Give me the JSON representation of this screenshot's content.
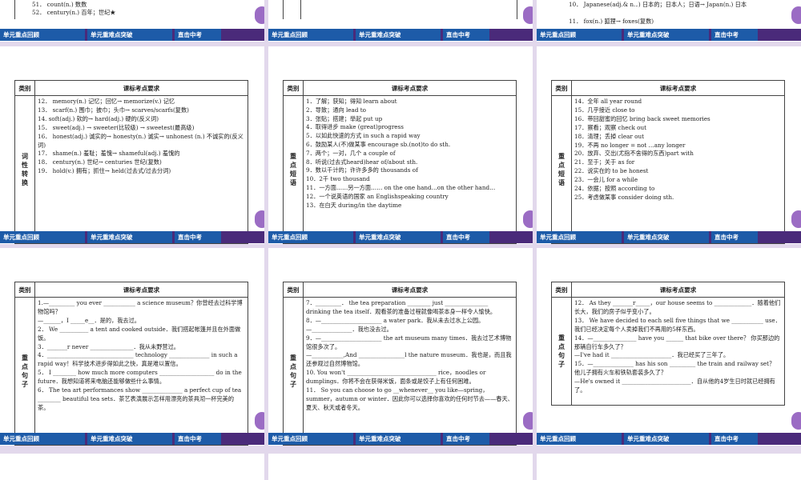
{
  "nav": [
    "单元重点回顾",
    "单元重难点突破",
    "直击中考"
  ],
  "top_slides": [
    {
      "lines": [
        "51． count(n.) 数数",
        "52． century(n.) 百年；世纪★"
      ]
    },
    {
      "lines": []
    },
    {
      "lines": [
        "10． Japanese(adj.& n.．) 日本的；日本人；日语→ Japan(n.) 日本",
        "11． fox(n.) 狐狸→ foxes(复数)"
      ]
    }
  ],
  "table_header": {
    "category": "类别",
    "requirement": "课标考点要求"
  },
  "middle_slides": [
    {
      "category": "词\n性\n转\n换",
      "lines": [
        "12． memory(n.) 记忆；回忆→ memorize(v.) 记忆",
        "13． scarf(n.) 围巾；披巾；头巾→ scarves/scarfs(复数)",
        "14. soft(adj.) 软的→ hard(adj.) 硬的(反义词)",
        "15． sweet(adj.) → sweeter(比较级) → sweetest(最高级)",
        "16． honest(adj.) 诚实的→ honesty(n.) 诚实→ unhonest (n.) 不诚实的(反义词)",
        "17． shame(n.) 羞耻；羞愧→ shameful(adj.) 羞愧的",
        "18． century(n.) 世纪→ centuries 世纪(复数)",
        "19． hold(v.) 拥有；抓住→ held(过去式/过去分词)"
      ]
    },
    {
      "category": "重\n点\n短\n语",
      "lines": [
        "1．了解；获知；得知 learn about",
        "2．导致；通向 lead to",
        "3．张贴；搭建；举起 put up",
        "4．取得进步 make (great)progress",
        "5．以如此快速的方式 in such a rapid way",
        "6．鼓励某人(不)做某事 encourage sb.(not)to do sth.",
        "7．两个；一对，几个 a couple of",
        "8．听说(过去式heard)hear of/about sth.",
        "9．数以千计的；许许多多的 thousands of",
        "10．2千 two thousand",
        "11．一方面……另一方面…… on the one hand…on the other hand…",
        "12．一个说英语的国家 an Englishspeaking country",
        "13．在白天 during/in the daytime"
      ]
    },
    {
      "category": "重\n点\n短\n语",
      "lines": [
        "14．全年 all year round",
        "15．几乎接近 close to",
        "16．带回甜蜜的回忆 bring back sweet memories",
        "17．察看；观察 check out",
        "18．清理；丢掉 clear out",
        "19．不再 no longer = not …any longer",
        "20．放弃、交出(尤指不舍得的东西)part with",
        "21．至于；关于 as for",
        "22．说实在的 to be honest",
        "23．一会儿 for a while",
        "24．依据；按照 according to",
        "25．考虑做某事 consider doing sth."
      ]
    }
  ],
  "bottom_row_slides": [
    {
      "category": "重\n点\n句\n子",
      "lines": [
        "1.—_________ you ever ___________ a science museum？你曾经去过科学博物馆吗？",
        "—______，I _____e__．是的，我去过。",
        "2． We __________ a tent and cooked outside．我们搭起帐篷并且在外面做饭。",
        "3．_______r never _______________．我从未野营过。",
        "4．______________________________ technology ______________ in such a rapid way！科学技术进步得如此之快，真是难以置信。",
        "5． I ________ how much more computers ___________________ do in the future．我想知道将来电脑还能够做些什么事情。",
        "6． The tea art performances show ______________ a perfect cup of tea ________ beautiful tea sets．茶艺表演展示怎样用漂亮的茶具沏一杯完美的茶。"
      ]
    },
    {
      "category": "重\n点\n句\n子",
      "lines": [
        "7．_________． the tea preparation ________ just _______________ drinking the tea itself．观看茶的准备过程就像喝茶本身一样令人愉快。",
        "8．—_____________________ a water park．我从未去过水上公园。",
        "—______________．我也没去过。",
        "9．—_____________________ the art museum many times．我去过艺术博物馆很多次了。",
        "—___________,And ________________l the nature museum．我也是，而且我还参观过自然博物馆。",
        "10. You won't _______________________________ rice，noodles or dumplings．你将不会在获得米饭，面条或是饺子上有任何困难。",
        "11． So you can choose to go __whenever__ you like—spring，summer，autumn or winter．因此你可以选择你喜欢的任何时节去——春天、夏天、秋天或者冬天。"
      ]
    },
    {
      "category": "重\n点\n句\n子",
      "lines": [
        "12． As they _______r_____，our house seems to _____________．随着他们长大，我们的房子似乎变小了。",
        "13． We have decided to each sell five things that we ___________ use．我们已经决定每个人卖掉我们不再用的5样东西。",
        "14．—_______________ have you ______ that bike over there？ 你买那边的那辆自行车多久了？",
        "—I've had it _____________________．我已经买了三年了。",
        "15．—______________ has his son _________ the train and railway set？ 他儿子拥有火车和铁轨套装多久了？",
        "—He's owned it ________________________．自从他的4岁生日时就已经拥有了。"
      ]
    }
  ]
}
